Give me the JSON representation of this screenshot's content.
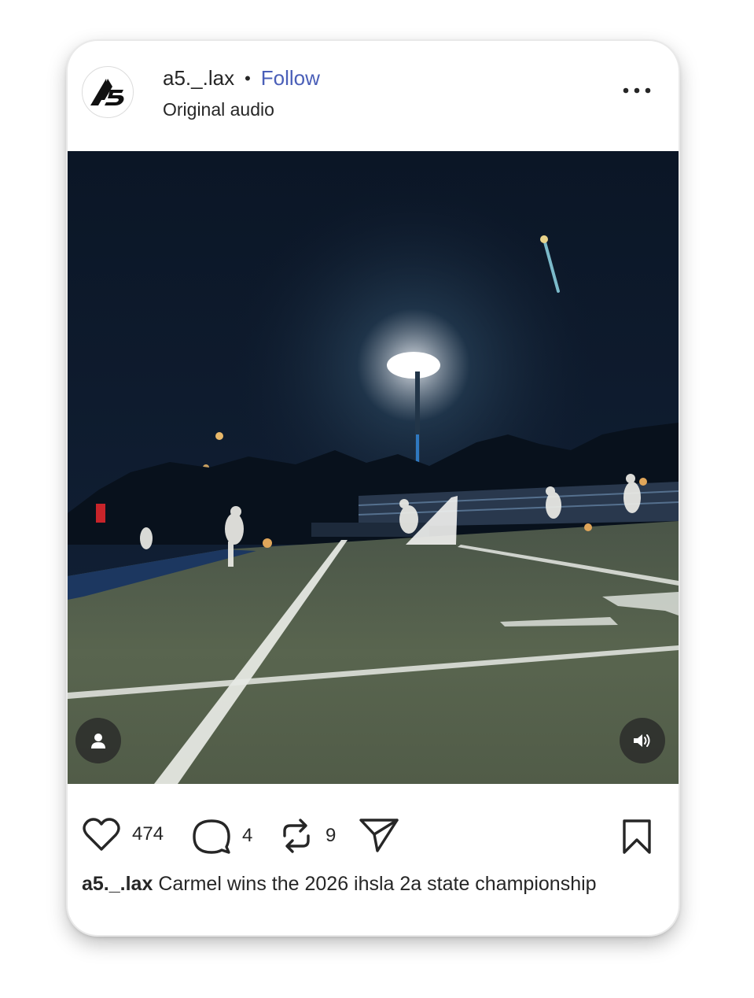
{
  "post": {
    "username": "a5._.lax",
    "separator": "•",
    "follow_label": "Follow",
    "audio": "Original audio",
    "icons": {
      "avatar": "a5-logo",
      "more": "more-horizontal-icon",
      "tag": "user-icon",
      "mute": "volume-icon",
      "like": "heart-icon",
      "comment": "comment-icon",
      "repost": "repost-icon",
      "share": "send-icon",
      "save": "bookmark-icon"
    }
  },
  "actions": {
    "likes": "474",
    "comments": "4",
    "reposts": "9"
  },
  "caption": {
    "username": "a5._.lax",
    "text": "Carmel wins the 2026 ihsla 2a state championship"
  }
}
